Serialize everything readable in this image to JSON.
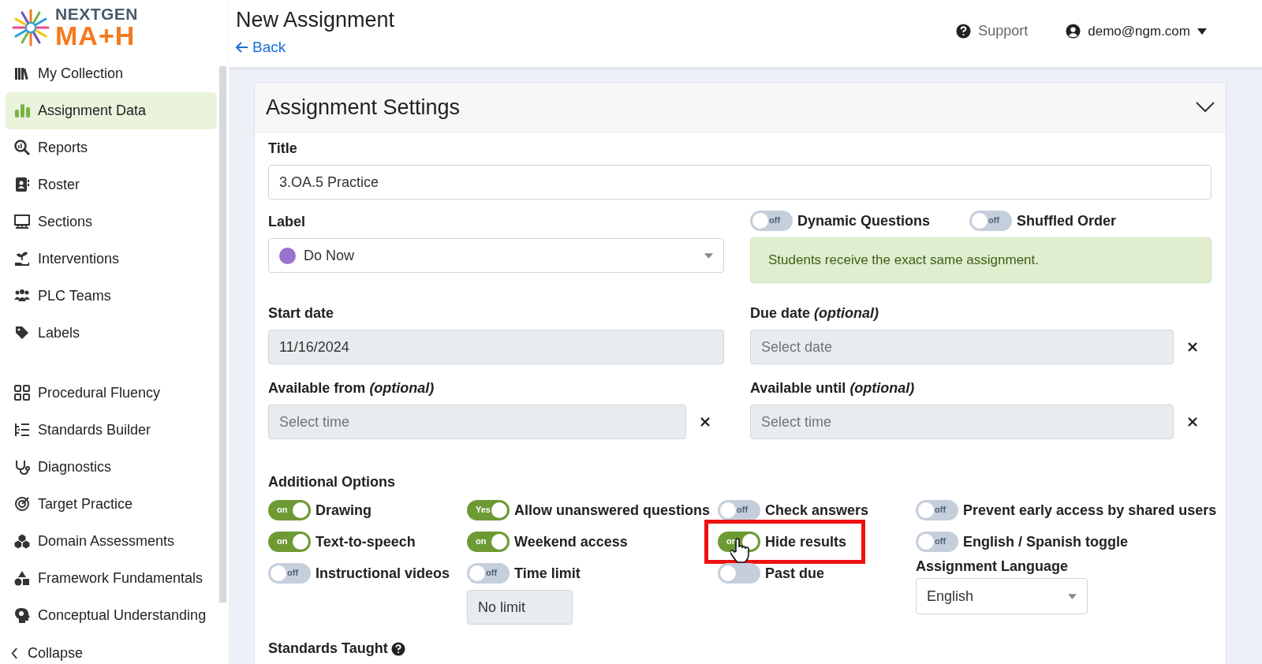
{
  "logo": {
    "line1": "NEXTGEN",
    "line2": "MA+H"
  },
  "header": {
    "title": "New Assignment",
    "back": "Back",
    "support": "Support",
    "user": "demo@ngm.com"
  },
  "sidebar": {
    "groups": [
      [
        {
          "label": "My Collection",
          "selected": false
        },
        {
          "label": "Assignment Data",
          "selected": true
        },
        {
          "label": "Reports",
          "selected": false
        },
        {
          "label": "Roster",
          "selected": false
        },
        {
          "label": "Sections",
          "selected": false
        },
        {
          "label": "Interventions",
          "selected": false
        },
        {
          "label": "PLC Teams",
          "selected": false
        },
        {
          "label": "Labels",
          "selected": false
        }
      ],
      [
        {
          "label": "Procedural Fluency",
          "selected": false
        },
        {
          "label": "Standards Builder",
          "selected": false
        },
        {
          "label": "Diagnostics",
          "selected": false
        },
        {
          "label": "Target Practice",
          "selected": false
        },
        {
          "label": "Domain Assessments",
          "selected": false
        },
        {
          "label": "Framework Fundamentals",
          "selected": false
        },
        {
          "label": "Conceptual Understanding",
          "selected": false
        }
      ]
    ],
    "collapse": "Collapse"
  },
  "panel": {
    "title": "Assignment Settings",
    "title_field": {
      "label": "Title",
      "value": "3.OA.5 Practice"
    },
    "label_field": {
      "label": "Label",
      "value": "Do Now",
      "color": "#9b72cf"
    },
    "top_toggles": [
      {
        "label": "Dynamic Questions",
        "switch_text": "off",
        "on": false
      },
      {
        "label": "Shuffled Order",
        "switch_text": "off",
        "on": false
      }
    ],
    "alert": "Students receive the exact same assignment.",
    "dates": [
      {
        "label": "Start date",
        "value": "11/16/2024",
        "clearable": false
      },
      {
        "label": "Due date *(optional)*",
        "placeholder": "Select date",
        "clearable": true
      },
      {
        "label": "Available from *(optional)*",
        "placeholder": "Select time",
        "clearable": true
      },
      {
        "label": "Available until *(optional)*",
        "placeholder": "Select time",
        "clearable": true
      }
    ],
    "additional_options": {
      "title": "Additional Options",
      "columns": [
        [
          {
            "kind": "toggle",
            "label": "Drawing",
            "switch_text": "on",
            "on": true,
            "highlighted": false
          },
          {
            "kind": "toggle",
            "label": "Text-to-speech",
            "switch_text": "on",
            "on": true,
            "highlighted": false
          },
          {
            "kind": "toggle",
            "label": "Instructional videos",
            "switch_text": "off",
            "on": false,
            "highlighted": false
          }
        ],
        [
          {
            "kind": "toggle",
            "label": "Allow unanswered questions",
            "switch_text": "Yes",
            "on": true,
            "highlighted": false
          },
          {
            "kind": "toggle",
            "label": "Weekend access",
            "switch_text": "on",
            "on": true,
            "highlighted": false
          },
          {
            "kind": "toggle",
            "label": "Time limit",
            "switch_text": "off",
            "on": false,
            "highlighted": false
          },
          {
            "kind": "field",
            "value": "No limit",
            "disabled": true
          }
        ],
        [
          {
            "kind": "toggle",
            "label": "Check answers",
            "switch_text": "off",
            "on": false,
            "highlighted": false
          },
          {
            "kind": "toggle",
            "label": "Hide results",
            "switch_text": "on",
            "on": true,
            "highlighted": true
          },
          {
            "kind": "toggle",
            "label": "Past due",
            "on": false,
            "highlighted": false
          }
        ],
        [
          {
            "kind": "toggle",
            "label": "Prevent early access by shared users",
            "switch_text": "off",
            "on": false,
            "highlighted": false
          },
          {
            "kind": "toggle",
            "label": "English / Spanish toggle",
            "switch_text": "off",
            "on": false,
            "highlighted": false
          },
          {
            "kind": "select",
            "label": "Assignment Language",
            "value": "English"
          }
        ]
      ]
    },
    "standards_taught": "Standards Taught"
  }
}
